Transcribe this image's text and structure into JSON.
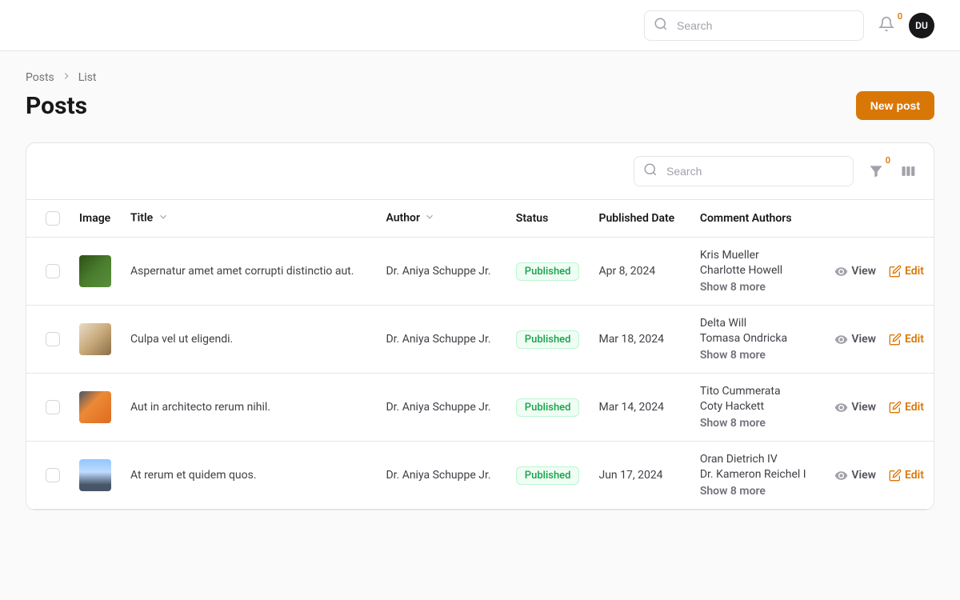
{
  "header": {
    "search_placeholder": "Search",
    "notification_count": "0",
    "avatar_initials": "DU"
  },
  "breadcrumb": {
    "item1": "Posts",
    "item2": "List"
  },
  "page": {
    "title": "Posts",
    "new_button": "New post"
  },
  "toolbar": {
    "search_placeholder": "Search",
    "filter_count": "0"
  },
  "columns": {
    "image": "Image",
    "title": "Title",
    "author": "Author",
    "status": "Status",
    "published_date": "Published Date",
    "comment_authors": "Comment Authors"
  },
  "actions": {
    "view": "View",
    "edit": "Edit"
  },
  "rows": [
    {
      "title": "Aspernatur amet amet corrupti distinctio aut.",
      "author": "Dr. Aniya Schuppe Jr.",
      "status": "Published",
      "date": "Apr 8, 2024",
      "comment1": "Kris Mueller",
      "comment2": "Charlotte Howell",
      "show_more": "Show 8 more"
    },
    {
      "title": "Culpa vel ut eligendi.",
      "author": "Dr. Aniya Schuppe Jr.",
      "status": "Published",
      "date": "Mar 18, 2024",
      "comment1": "Delta Will",
      "comment2": "Tomasa Ondricka",
      "show_more": "Show 8 more"
    },
    {
      "title": "Aut in architecto rerum nihil.",
      "author": "Dr. Aniya Schuppe Jr.",
      "status": "Published",
      "date": "Mar 14, 2024",
      "comment1": "Tito Cummerata",
      "comment2": "Coty Hackett",
      "show_more": "Show 8 more"
    },
    {
      "title": "At rerum et quidem quos.",
      "author": "Dr. Aniya Schuppe Jr.",
      "status": "Published",
      "date": "Jun 17, 2024",
      "comment1": "Oran Dietrich IV",
      "comment2": "Dr. Kameron Reichel I",
      "show_more": "Show 8 more"
    }
  ]
}
